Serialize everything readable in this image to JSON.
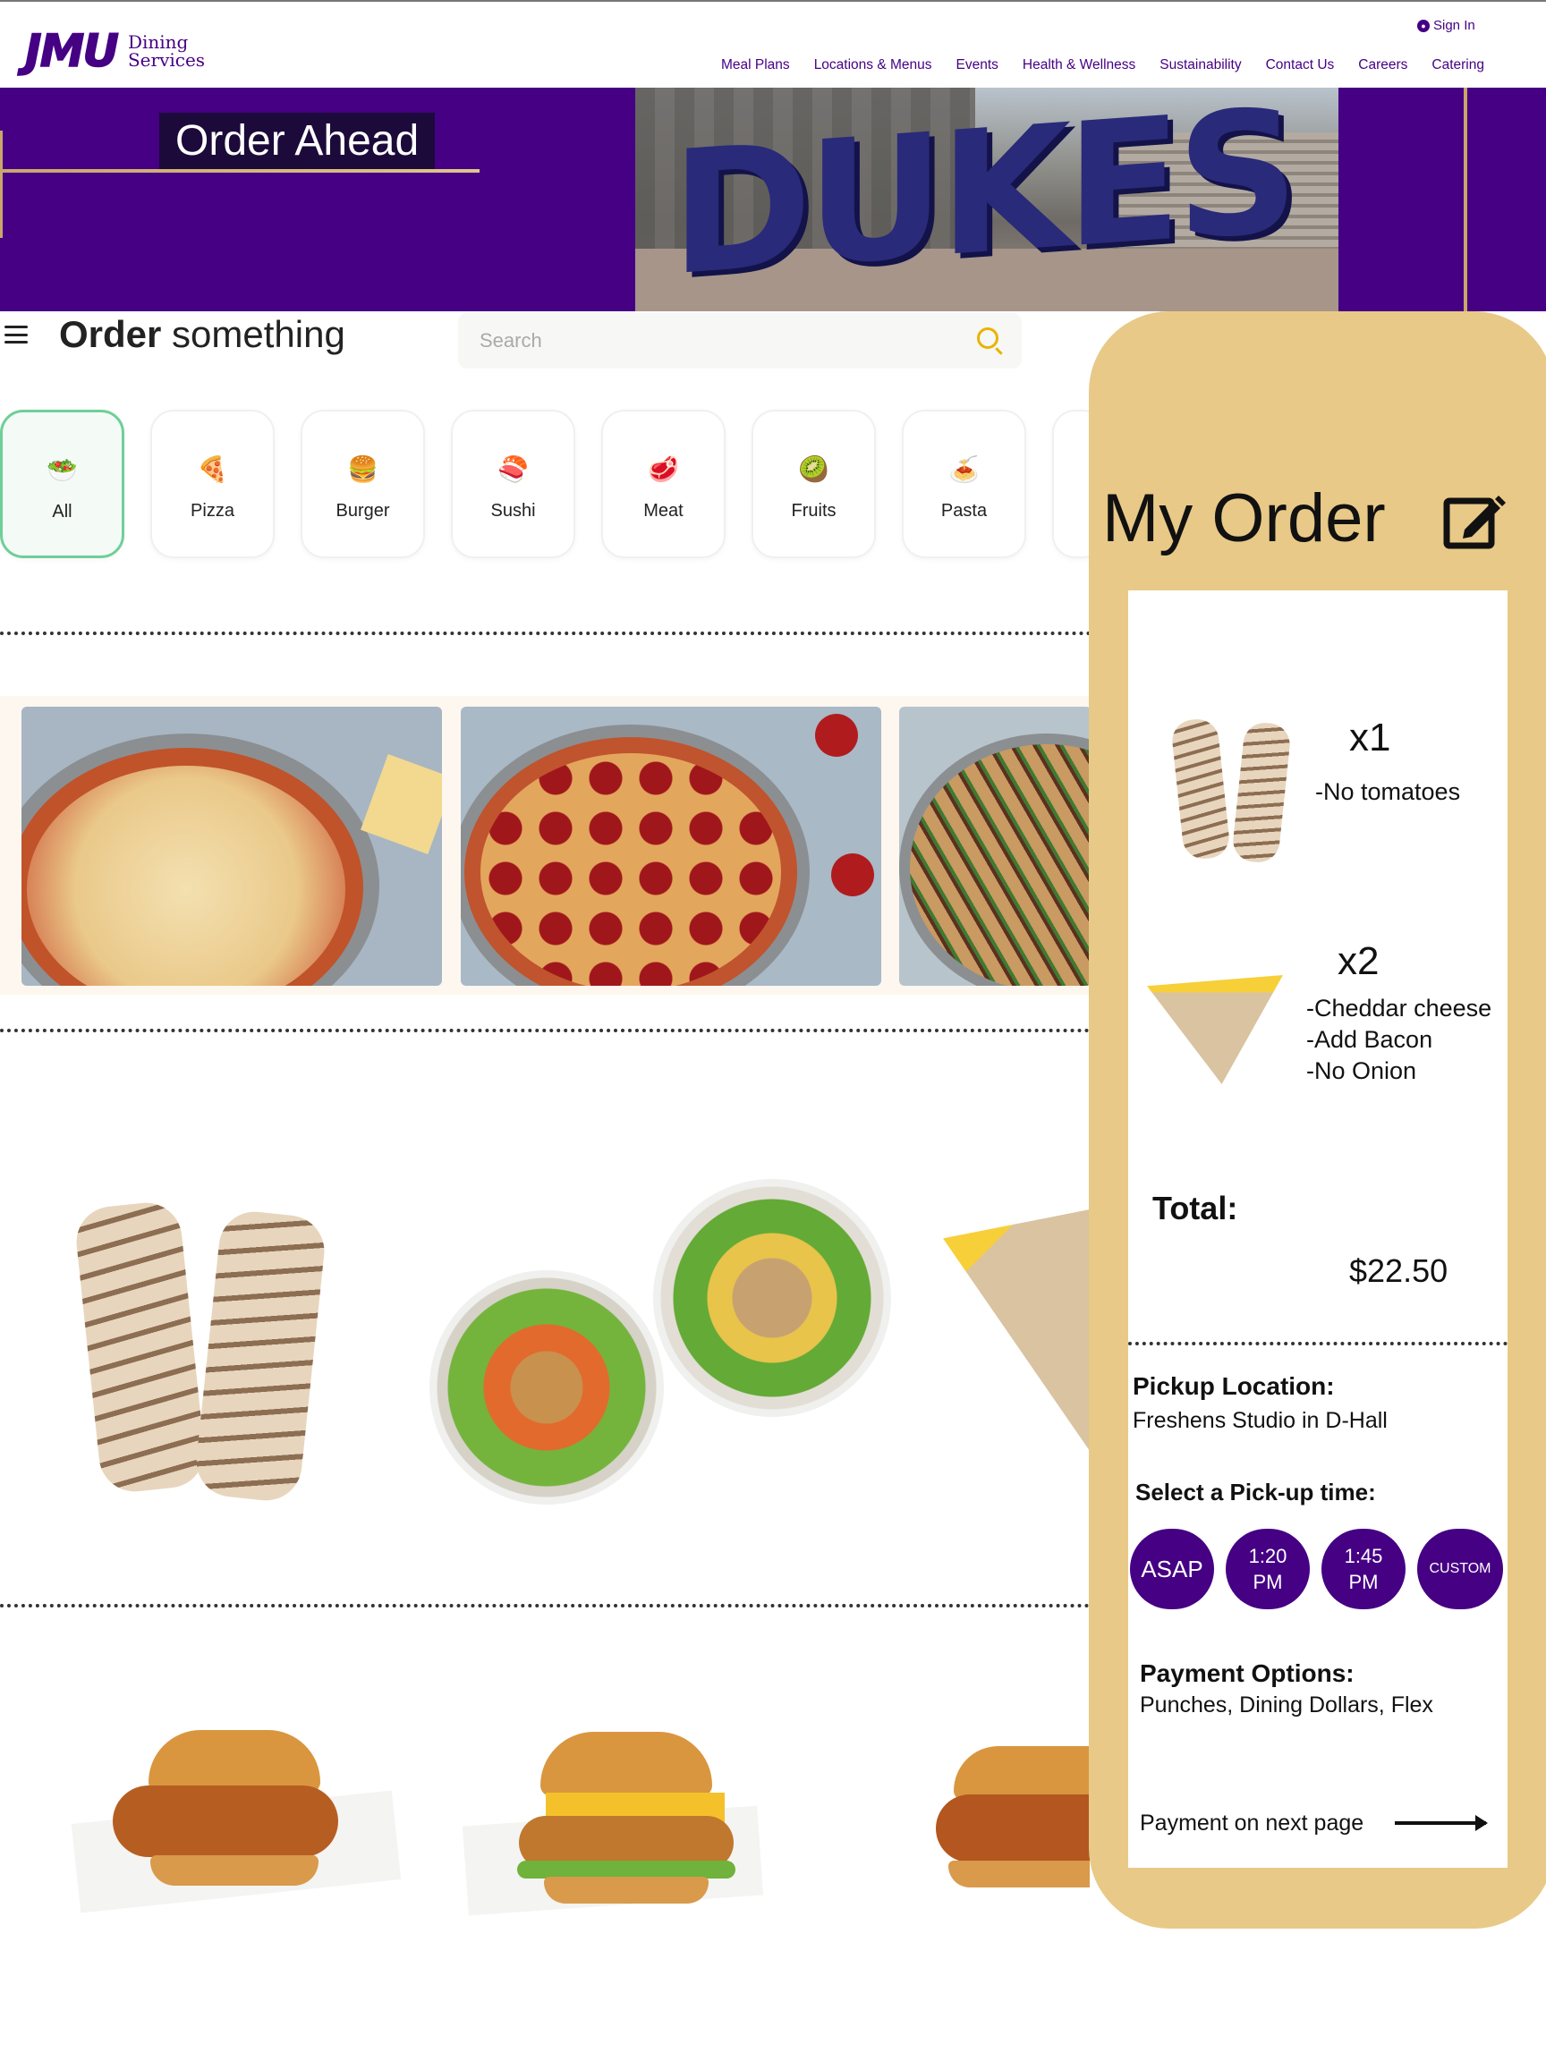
{
  "header": {
    "logo_mark": "JMU",
    "logo_sub_line1": "Dining",
    "logo_sub_line2": "Services",
    "sign_in": "Sign In",
    "nav": [
      "Meal Plans",
      "Locations & Menus",
      "Events",
      "Health & Wellness",
      "Sustainability",
      "Contact Us",
      "Careers",
      "Catering"
    ]
  },
  "banner": {
    "title": "Order Ahead",
    "photo_sign": "DUKES"
  },
  "order": {
    "title_bold": "Order",
    "title_rest": " something",
    "search_placeholder": "Search",
    "categories": [
      {
        "label": "All",
        "icon": "salad-icon",
        "glyph": "🥗"
      },
      {
        "label": "Pizza",
        "icon": "pizza-icon",
        "glyph": "🍕"
      },
      {
        "label": "Burger",
        "icon": "burger-icon",
        "glyph": "🍔"
      },
      {
        "label": "Sushi",
        "icon": "sushi-icon",
        "glyph": "🍣"
      },
      {
        "label": "Meat",
        "icon": "meat-icon",
        "glyph": "🥩"
      },
      {
        "label": "Fruits",
        "icon": "kiwi-icon",
        "glyph": "🥝"
      },
      {
        "label": "Pasta",
        "icon": "pasta-icon",
        "glyph": "🍝"
      }
    ]
  },
  "my_order": {
    "title": "My Order",
    "items": [
      {
        "qty": "x1",
        "mods": [
          "-No tomatoes"
        ]
      },
      {
        "qty": "x2",
        "mods": [
          "-Cheddar cheese",
          "-Add Bacon",
          "-No Onion"
        ]
      }
    ],
    "total_label": "Total:",
    "total_value": "$22.50",
    "pickup_label": "Pickup Location:",
    "pickup_value": "Freshens Studio in D-Hall",
    "time_label": "Select a Pick-up time:",
    "times": [
      {
        "line1": "ASAP",
        "line2": ""
      },
      {
        "line1": "1:20",
        "line2": "PM"
      },
      {
        "line1": "1:45",
        "line2": "PM"
      },
      {
        "line1": "CUSTOM",
        "line2": ""
      }
    ],
    "payment_label": "Payment Options:",
    "payment_value": "Punches, Dining Dollars, Flex",
    "next_label": "Payment on next page"
  },
  "colors": {
    "jmu_purple": "#450084",
    "gold": "#e8c987",
    "active_category": "#6fcf97"
  }
}
